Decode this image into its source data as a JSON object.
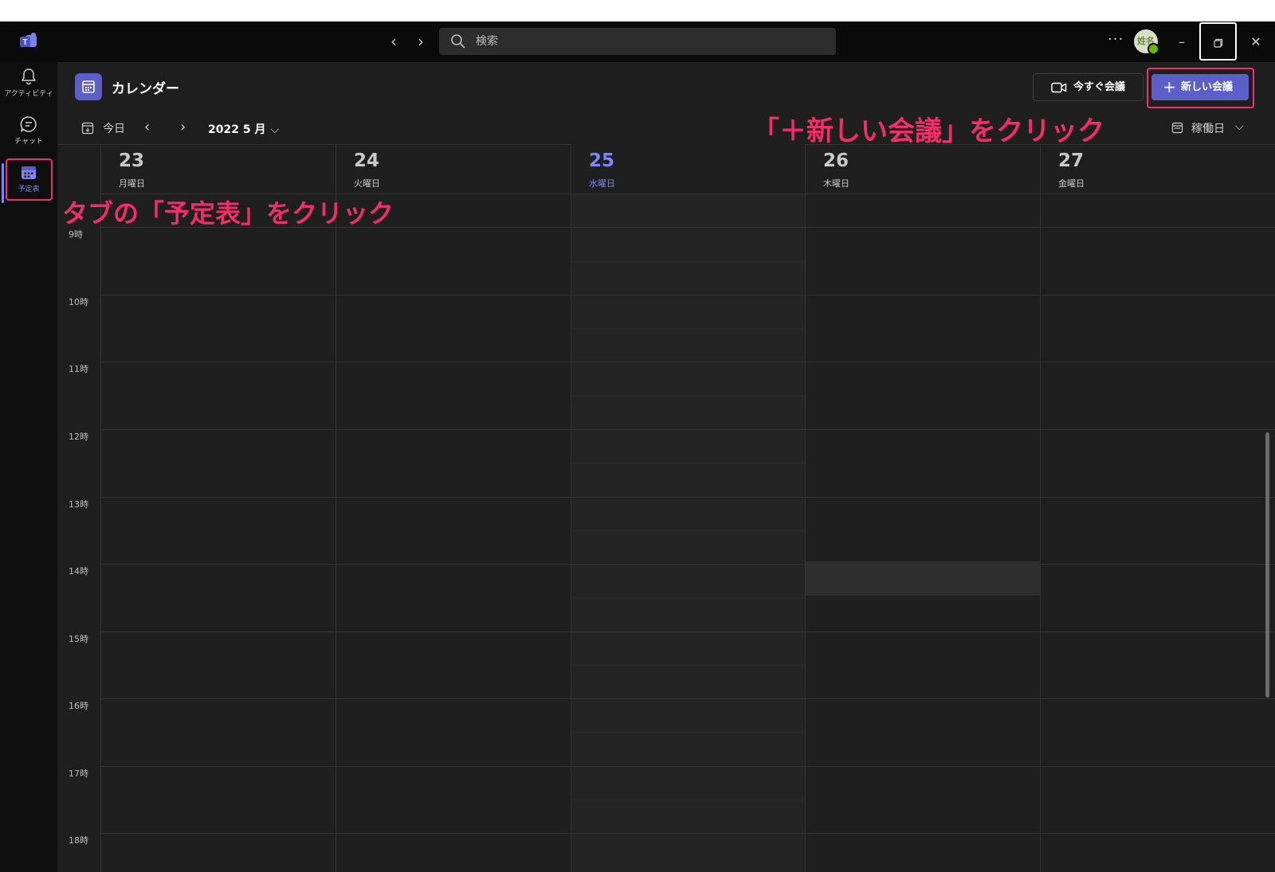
{
  "titlebar": {
    "search_placeholder": "検索",
    "avatar_text": "姓名",
    "more": "···",
    "minimize": "–",
    "close": "✕"
  },
  "rail": {
    "items": [
      {
        "label": "アクティビティ",
        "icon": "bell-icon"
      },
      {
        "label": "チャット",
        "icon": "chat-icon"
      },
      {
        "label": "予定表",
        "icon": "calendar-icon"
      }
    ]
  },
  "header": {
    "title": "カレンダー",
    "meet_now": "今すぐ会議",
    "new_meeting": "新しい会議"
  },
  "nav": {
    "today": "今日",
    "month": "2022 5 月",
    "view": "稼働日"
  },
  "days": [
    {
      "num": "23",
      "name": "月曜日"
    },
    {
      "num": "24",
      "name": "火曜日"
    },
    {
      "num": "25",
      "name": "水曜日"
    },
    {
      "num": "26",
      "name": "木曜日"
    },
    {
      "num": "27",
      "name": "金曜日"
    }
  ],
  "hours": [
    "9時",
    "10時",
    "11時",
    "12時",
    "13時",
    "14時",
    "15時",
    "16時",
    "17時",
    "18時"
  ],
  "annotations": {
    "tab": "タブの「予定表」をクリック",
    "new": "「＋新しい会議」をクリック"
  },
  "colors": {
    "accent": "#5b5fc7",
    "today": "#7f85f5",
    "annotation": "#ef2e6b"
  }
}
